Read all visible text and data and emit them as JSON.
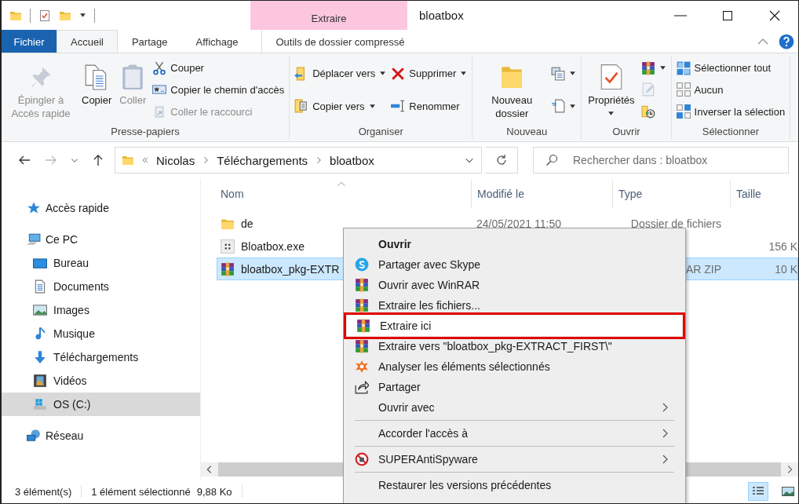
{
  "window": {
    "title": "bloatbox",
    "context_tab_header": "Extraire"
  },
  "ribbon_tabs": [
    {
      "label": "Fichier",
      "selected": false,
      "kind": "file"
    },
    {
      "label": "Accueil",
      "selected": true,
      "kind": "tab"
    },
    {
      "label": "Partage",
      "selected": false,
      "kind": "tab"
    },
    {
      "label": "Affichage",
      "selected": false,
      "kind": "tab"
    },
    {
      "label": "Outils de dossier compressé",
      "selected": false,
      "kind": "context"
    }
  ],
  "ribbon": {
    "groups": [
      {
        "label": "Presse-papiers",
        "items": [
          {
            "kind": "large",
            "label": "Épingler à Accès rapide",
            "disabled": true,
            "dropdown": false
          },
          {
            "kind": "large",
            "label": "Copier",
            "disabled": false,
            "dropdown": false
          },
          {
            "kind": "large",
            "label": "Coller",
            "disabled": true,
            "dropdown": false
          },
          {
            "kind": "small",
            "label": "Couper",
            "disabled": false,
            "dropdown": false
          },
          {
            "kind": "small",
            "label": "Copier le chemin d'accès",
            "disabled": false,
            "dropdown": false
          },
          {
            "kind": "small",
            "label": "Coller le raccourci",
            "disabled": true,
            "dropdown": false
          }
        ]
      },
      {
        "label": "Organiser",
        "items": [
          {
            "kind": "small",
            "label": "Déplacer vers",
            "disabled": false,
            "dropdown": true
          },
          {
            "kind": "small",
            "label": "Copier vers",
            "disabled": false,
            "dropdown": true
          },
          {
            "kind": "small",
            "label": "Supprimer",
            "disabled": false,
            "dropdown": true
          },
          {
            "kind": "small",
            "label": "Renommer",
            "disabled": false,
            "dropdown": false
          }
        ]
      },
      {
        "label": "Nouveau",
        "items": [
          {
            "kind": "large",
            "label": "Nouveau dossier",
            "disabled": false,
            "dropdown": false
          },
          {
            "kind": "icon",
            "disabled": false,
            "dropdown": true
          },
          {
            "kind": "icon",
            "disabled": false,
            "dropdown": true
          }
        ]
      },
      {
        "label": "Ouvrir",
        "items": [
          {
            "kind": "large",
            "label": "Propriétés",
            "disabled": false,
            "dropdown": true
          },
          {
            "kind": "icon",
            "disabled": false,
            "dropdown": true
          },
          {
            "kind": "icon",
            "disabled": true,
            "dropdown": false
          },
          {
            "kind": "icon",
            "disabled": false,
            "dropdown": false
          }
        ]
      },
      {
        "label": "Sélectionner",
        "items": [
          {
            "kind": "small",
            "label": "Sélectionner tout",
            "disabled": false,
            "dropdown": false
          },
          {
            "kind": "small",
            "label": "Aucun",
            "disabled": false,
            "dropdown": false
          },
          {
            "kind": "small",
            "label": "Inverser la sélection",
            "disabled": false,
            "dropdown": false
          }
        ]
      }
    ]
  },
  "address": {
    "breadcrumb": [
      "Nicolas",
      "Téléchargements",
      "bloatbox"
    ]
  },
  "search": {
    "placeholder": "Rechercher dans : bloatbox"
  },
  "navigation": [
    {
      "label": "Accès rapide",
      "selected": false
    },
    {
      "label": "Ce PC",
      "selected": false,
      "children": [
        {
          "label": "Bureau",
          "selected": false
        },
        {
          "label": "Documents",
          "selected": false
        },
        {
          "label": "Images",
          "selected": false
        },
        {
          "label": "Musique",
          "selected": false
        },
        {
          "label": "Téléchargements",
          "selected": false
        },
        {
          "label": "Vidéos",
          "selected": false
        },
        {
          "label": "OS (C:)",
          "selected": true
        }
      ]
    },
    {
      "label": "Réseau",
      "selected": false
    }
  ],
  "file_list": {
    "columns": [
      "Nom",
      "Modifié le",
      "Type",
      "Taille"
    ],
    "rows": [
      {
        "kind": "folder",
        "name": "de",
        "modified": "24/05/2021 11:50",
        "type": "Dossier de fichiers",
        "selected": false
      },
      {
        "kind": "app",
        "name": "Bloatbox.exe",
        "size": "156 K",
        "selected": false
      },
      {
        "kind": "archive",
        "name": "bloatbox_pkg-EXTR",
        "type": "AR ZIP",
        "size": "10 K",
        "selected": true
      }
    ]
  },
  "context_menu": [
    {
      "kind": "text",
      "label": "Ouvrir",
      "default": true,
      "highlighted": false,
      "submenu": false
    },
    {
      "kind": "logo",
      "label": "Partager avec Skype",
      "default": false,
      "highlighted": false,
      "submenu": false
    },
    {
      "kind": "archive",
      "label": "Ouvrir avec WinRAR",
      "default": false,
      "highlighted": false,
      "submenu": false
    },
    {
      "kind": "archive",
      "label": "Extraire les fichiers...",
      "default": false,
      "highlighted": false,
      "submenu": false
    },
    {
      "kind": "archive",
      "label": "Extraire ici",
      "default": false,
      "highlighted": true,
      "submenu": false
    },
    {
      "kind": "archive",
      "label": "Extraire vers \"bloatbox_pkg-EXTRACT_FIRST\\\"",
      "default": false,
      "highlighted": false,
      "submenu": false
    },
    {
      "kind": "scan",
      "label": "Analyser les éléments sélectionnés",
      "default": false,
      "highlighted": false,
      "submenu": false
    },
    {
      "kind": "share",
      "label": "Partager",
      "default": false,
      "highlighted": false,
      "submenu": false
    },
    {
      "kind": "text",
      "label": "Ouvrir avec",
      "default": false,
      "highlighted": false,
      "submenu": true
    },
    {
      "kind": "separator"
    },
    {
      "kind": "text",
      "label": "Accorder l'accès à",
      "default": false,
      "highlighted": false,
      "submenu": true
    },
    {
      "kind": "separator"
    },
    {
      "kind": "blocked",
      "label": "SUPERAntiSpyware",
      "default": false,
      "highlighted": false,
      "submenu": true
    },
    {
      "kind": "separator"
    },
    {
      "kind": "text",
      "label": "Restaurer les versions précédentes",
      "default": false,
      "highlighted": false,
      "submenu": false
    }
  ],
  "status_bar": {
    "item_count": "3 élément(s)",
    "selection": "1 élément sélectionné",
    "selection_size": "9,88 Ko"
  },
  "view_modes": [
    {
      "kind": "details",
      "selected": true
    },
    {
      "kind": "large_icons",
      "selected": false
    }
  ]
}
